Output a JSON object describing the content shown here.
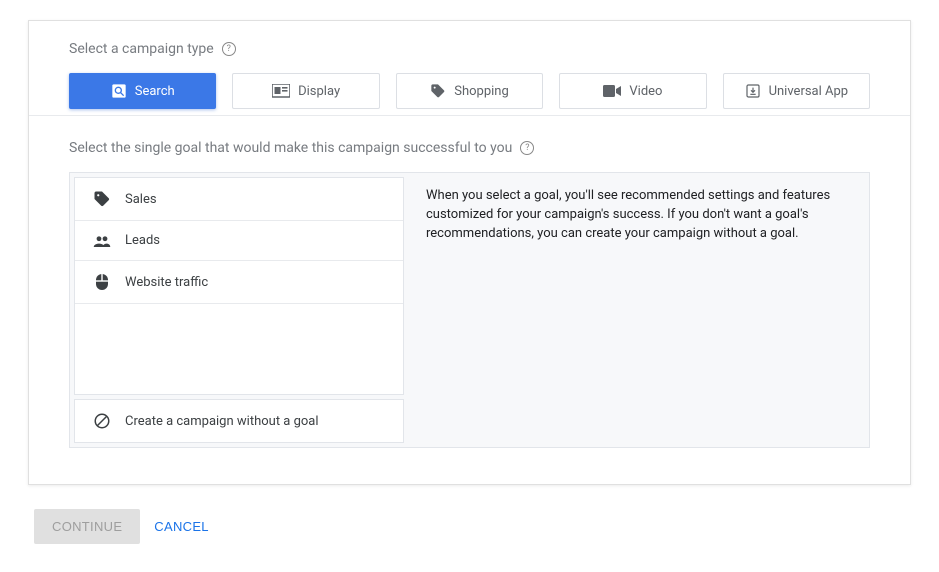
{
  "campaign_type": {
    "label": "Select a campaign type",
    "tabs": [
      {
        "label": "Search",
        "selected": true
      },
      {
        "label": "Display",
        "selected": false
      },
      {
        "label": "Shopping",
        "selected": false
      },
      {
        "label": "Video",
        "selected": false
      },
      {
        "label": "Universal App",
        "selected": false
      }
    ]
  },
  "goal": {
    "label": "Select the single goal that would make this campaign successful to you",
    "items": [
      {
        "label": "Sales"
      },
      {
        "label": "Leads"
      },
      {
        "label": "Website traffic"
      }
    ],
    "create_without_goal_label": "Create a campaign without a goal",
    "description": "When you select a goal, you'll see recommended settings and features customized for your campaign's success. If you don't want a goal's recommendations, you can create your campaign without a goal."
  },
  "footer": {
    "continue_label": "CONTINUE",
    "cancel_label": "CANCEL"
  }
}
